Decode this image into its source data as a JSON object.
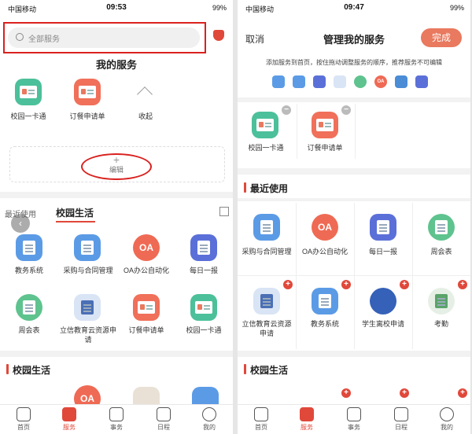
{
  "left": {
    "status": {
      "carrier": "中国移动",
      "time": "09:53",
      "battery": "99%"
    },
    "search": {
      "placeholder": "全部服务"
    },
    "my_services": {
      "title": "我的服务",
      "items": [
        {
          "label": "校园一卡通",
          "icon": "campus-card-icon"
        },
        {
          "label": "订餐申请单",
          "icon": "meal-order-icon"
        }
      ],
      "collapse_label": "收起",
      "edit_label": "编辑"
    },
    "tabs": {
      "recent": "最近使用",
      "active": "校园生活"
    },
    "grid": [
      {
        "label": "教务系统"
      },
      {
        "label": "采购与合同管理"
      },
      {
        "label": "OA办公自动化"
      },
      {
        "label": "每日一报"
      },
      {
        "label": "周会表"
      },
      {
        "label": "立信教育云资源申请"
      },
      {
        "label": "订餐申请单"
      },
      {
        "label": "校园一卡通"
      }
    ],
    "section2_title": "校园生活",
    "nav": [
      "首页",
      "服务",
      "事务",
      "日程",
      "我的"
    ]
  },
  "right": {
    "status": {
      "carrier": "中国移动",
      "time": "09:47",
      "battery": "99%"
    },
    "cancel_label": "取消",
    "title": "管理我的服务",
    "done_label": "完成",
    "hint": "添加服务到首页，按住拖动调整服务的顺序，推荐服务不可编辑",
    "my_items": [
      {
        "label": "校园一卡通"
      },
      {
        "label": "订餐申请单"
      }
    ],
    "recent_title": "最近使用",
    "recent": [
      {
        "label": "采购与合同管理"
      },
      {
        "label": "OA办公自动化"
      },
      {
        "label": "每日一报"
      },
      {
        "label": "周会表"
      },
      {
        "label": "立信教育云资源申请"
      },
      {
        "label": "教务系统"
      },
      {
        "label": "学生离校申请"
      },
      {
        "label": "考勤"
      }
    ],
    "section2_title": "校园生活",
    "nav": [
      "首页",
      "服务",
      "事务",
      "日程",
      "我的"
    ]
  },
  "colors": {
    "accent": "#e0483a",
    "highlight": "#d9211e",
    "blue": "#3d86e0",
    "green": "#4cc09a"
  }
}
